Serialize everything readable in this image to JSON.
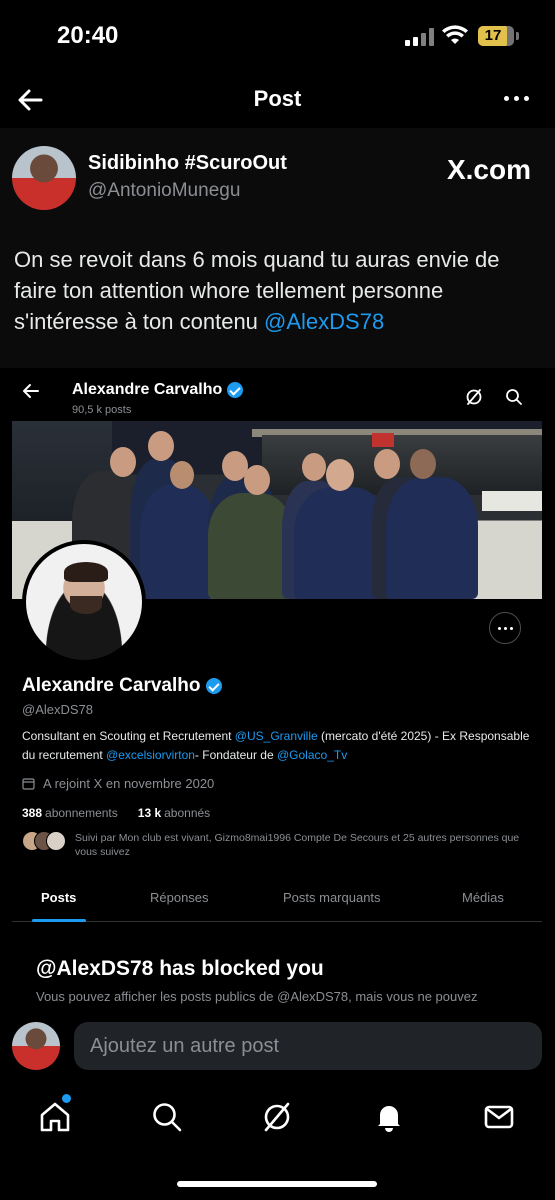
{
  "status_bar": {
    "time": "20:40",
    "battery": "17",
    "battery_color": "#e1c14b"
  },
  "header": {
    "title": "Post",
    "back_icon": "arrow-left-icon",
    "more_icon": "more-horizontal-icon"
  },
  "post": {
    "author_name": "Sidibinho #ScuroOut",
    "author_handle": "@AntonioMunegu",
    "source_label": "X.com",
    "text": "On se revoit dans 6 mois quand tu auras envie de faire ton attention whore tellement personne s'intéresse à ton contenu ",
    "mention": "@AlexDS78"
  },
  "embed": {
    "top_name": "Alexandre Carvalho",
    "top_posts": "90,5 k posts",
    "profile_name": "Alexandre Carvalho",
    "profile_handle": "@AlexDS78",
    "bio_part1": "Consultant en Scouting et Recrutement ",
    "bio_link1": "@US_Granville",
    "bio_part2": " (mercato d'été 2025) - Ex Responsable du recrutement ",
    "bio_link2": "@excelsiorvirton",
    "bio_part3": "- Fondateur de ",
    "bio_link3": "@Golaco_Tv",
    "joined": "A rejoint X en novembre 2020",
    "following_count": "388",
    "following_label": "abonnements",
    "followers_count": "13 k",
    "followers_label": "abonnés",
    "followed_by": "Suivi par Mon club est vivant, Gizmo8mai1996 Compte De Secours et 25 autres personnes que vous suivez",
    "tabs": [
      "Posts",
      "Réponses",
      "Posts marquants",
      "Médias"
    ],
    "blocked_title": "@AlexDS78 has blocked you",
    "blocked_text": "Vous pouvez afficher les posts publics de @AlexDS78, mais vous ne pouvez"
  },
  "reply": {
    "placeholder": "Ajoutez un autre post"
  },
  "tabbar": {
    "items": [
      "home-icon",
      "search-icon",
      "grok-icon",
      "notifications-icon",
      "messages-icon"
    ],
    "accent": "#1d9bf0"
  }
}
